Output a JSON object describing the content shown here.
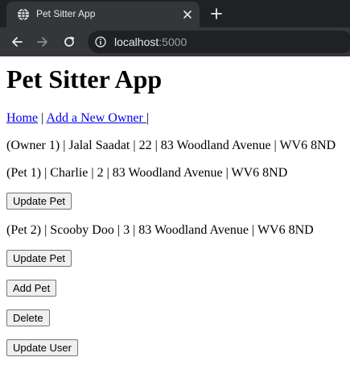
{
  "browser": {
    "tab_title": "Pet Sitter App",
    "url_host": "localhost",
    "url_port": ":5000"
  },
  "page": {
    "title": "Pet Sitter App",
    "nav": {
      "home": "Home",
      "sep1": " | ",
      "add_owner": "Add a New Owner ",
      "sep2": "|"
    },
    "owner_line": "(Owner 1) | Jalal Saadat | 22 | 83 Woodland Avenue | WV6 8ND",
    "pets": [
      {
        "line": "(Pet 1) | Charlie | 2 | 83 Woodland Avenue | WV6 8ND",
        "button": "Update Pet"
      },
      {
        "line": "(Pet 2) | Scooby Doo | 3 | 83 Woodland Avenue | WV6 8ND",
        "button": "Update Pet"
      }
    ],
    "add_pet_button": "Add Pet",
    "delete_button": "Delete",
    "update_user_button": "Update User"
  }
}
